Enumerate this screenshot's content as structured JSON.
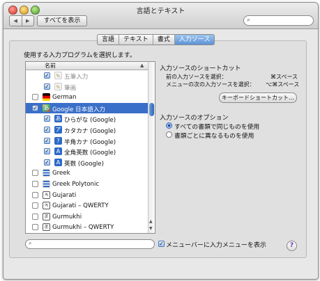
{
  "window": {
    "title": "言語とテキスト"
  },
  "toolbar": {
    "back_icon": "◀",
    "forward_icon": "▶",
    "show_all": "すべてを表示",
    "search_icon": "⌕"
  },
  "tabs": [
    {
      "label": "言語",
      "active": false
    },
    {
      "label": "テキスト",
      "active": false
    },
    {
      "label": "書式",
      "active": false
    },
    {
      "label": "入力ソース",
      "active": true
    }
  ],
  "instruction": "使用する入力プログラムを選択します。",
  "list": {
    "header_name": "名前",
    "header_sort": "▲",
    "rows": [
      {
        "icon": "pen-icon",
        "glyph": "✎",
        "label": "五筆入力",
        "checked": true,
        "indent": true,
        "dim": true
      },
      {
        "icon": "pen-icon",
        "glyph": "✎",
        "label": "筆画",
        "checked": true,
        "indent": true,
        "dim": true
      },
      {
        "icon": "flag-germany-icon",
        "glyph": "",
        "label": "German",
        "checked": false,
        "indent": false
      },
      {
        "icon": "google-ime-icon",
        "glyph": "あ",
        "label": "Google 日本語入力",
        "checked": true,
        "indent": false,
        "selected": true
      },
      {
        "icon": "hiragana-icon",
        "glyph": "あ",
        "label": "ひらがな (Google)",
        "checked": true,
        "indent": true
      },
      {
        "icon": "katakana-icon",
        "glyph": "ア",
        "label": "カタカナ (Google)",
        "checked": true,
        "indent": true
      },
      {
        "icon": "half-katakana-icon",
        "glyph": "ｱ",
        "label": "半角カナ (Google)",
        "checked": true,
        "indent": true
      },
      {
        "icon": "fullwidth-alpha-icon",
        "glyph": "A",
        "label": "全角英数 (Google)",
        "checked": true,
        "indent": true
      },
      {
        "icon": "alpha-icon",
        "glyph": "A",
        "label": "英数 (Google)",
        "checked": true,
        "indent": true
      },
      {
        "icon": "flag-greece-icon",
        "glyph": "",
        "label": "Greek",
        "checked": false,
        "indent": false
      },
      {
        "icon": "flag-greece-icon",
        "glyph": "",
        "label": "Greek Polytonic",
        "checked": false,
        "indent": false
      },
      {
        "icon": "gujarati-icon",
        "glyph": "ગ",
        "label": "Gujarati",
        "checked": false,
        "indent": false
      },
      {
        "icon": "gujarati-icon",
        "glyph": "ગ",
        "label": "Gujarati – QWERTY",
        "checked": false,
        "indent": false
      },
      {
        "icon": "gurmukhi-icon",
        "glyph": "ਗ",
        "label": "Gurmukhi",
        "checked": false,
        "indent": false
      },
      {
        "icon": "gurmukhi-icon",
        "glyph": "ਗ",
        "label": "Gurmukhi – QWERTY",
        "checked": false,
        "indent": false
      }
    ]
  },
  "shortcuts": {
    "heading": "入力ソースのショートカット",
    "prev_label": "前の入力ソースを選択：",
    "prev_key": "⌘スペース",
    "next_label": "メニューの次の入力ソースを選択：",
    "next_key": "⌥⌘スペース",
    "keyboard_button": "キーボードショートカット…"
  },
  "options": {
    "heading": "入力ソースのオプション",
    "radio_same": "すべての書類で同じものを使用",
    "radio_per_doc": "書類ごとに異なるものを使用",
    "selected": "same"
  },
  "bottom": {
    "menu_checkbox_label": "メニューバーに入力メニューを表示",
    "menu_checked": true,
    "help": "?"
  },
  "colors": {
    "selection": "#3a6fc9",
    "accent": "#2d69c9"
  }
}
